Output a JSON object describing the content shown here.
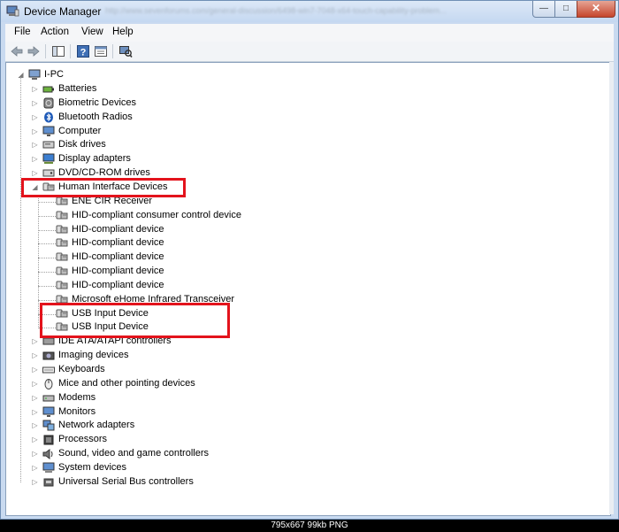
{
  "window": {
    "title": "Device Manager",
    "blurred_address": "http://www.sevenforums.com/general-discussion/6498-win7-7048-x64-touch-capability-problem...",
    "min_glyph": "—",
    "max_glyph": "□",
    "close_glyph": "✕"
  },
  "menu": {
    "file": "File",
    "action": "Action",
    "view": "View",
    "help": "Help"
  },
  "tree": {
    "root": "I-PC",
    "expanded_glyph": "◢",
    "collapsed_glyph": "▷",
    "categories_before": [
      {
        "label": "Batteries",
        "icon": "battery-icon"
      },
      {
        "label": "Biometric Devices",
        "icon": "fingerprint-icon"
      },
      {
        "label": "Bluetooth Radios",
        "icon": "bluetooth-icon"
      },
      {
        "label": "Computer",
        "icon": "monitor-icon"
      },
      {
        "label": "Disk drives",
        "icon": "disk-drive-icon"
      },
      {
        "label": "Display adapters",
        "icon": "display-adapter-icon"
      },
      {
        "label": "DVD/CD-ROM drives",
        "icon": "dvd-drive-icon"
      }
    ],
    "expanded_category": {
      "label": "Human Interface Devices",
      "children": [
        "ENE CIR Receiver",
        "HID-compliant consumer control device",
        "HID-compliant device",
        "HID-compliant device",
        "HID-compliant device",
        "HID-compliant device",
        "HID-compliant device",
        "Microsoft eHome Infrared Transceiver",
        "USB Input Device",
        "USB Input Device"
      ]
    },
    "categories_after": [
      {
        "label": "IDE ATA/ATAPI controllers",
        "icon": "ide-controller-icon"
      },
      {
        "label": "Imaging devices",
        "icon": "camera-icon"
      },
      {
        "label": "Keyboards",
        "icon": "keyboard-icon"
      },
      {
        "label": "Mice and other pointing devices",
        "icon": "mouse-icon"
      },
      {
        "label": "Modems",
        "icon": "modem-icon"
      },
      {
        "label": "Monitors",
        "icon": "monitor-icon"
      },
      {
        "label": "Network adapters",
        "icon": "network-adapter-icon"
      },
      {
        "label": "Processors",
        "icon": "processor-icon"
      },
      {
        "label": "Sound, video and game controllers",
        "icon": "sound-icon"
      },
      {
        "label": "System devices",
        "icon": "system-device-icon"
      },
      {
        "label": "Universal Serial Bus controllers",
        "icon": "usb-icon"
      }
    ]
  },
  "image_info": "795x667  99kb  PNG",
  "colors": {
    "highlight_box": "#e3131c"
  }
}
